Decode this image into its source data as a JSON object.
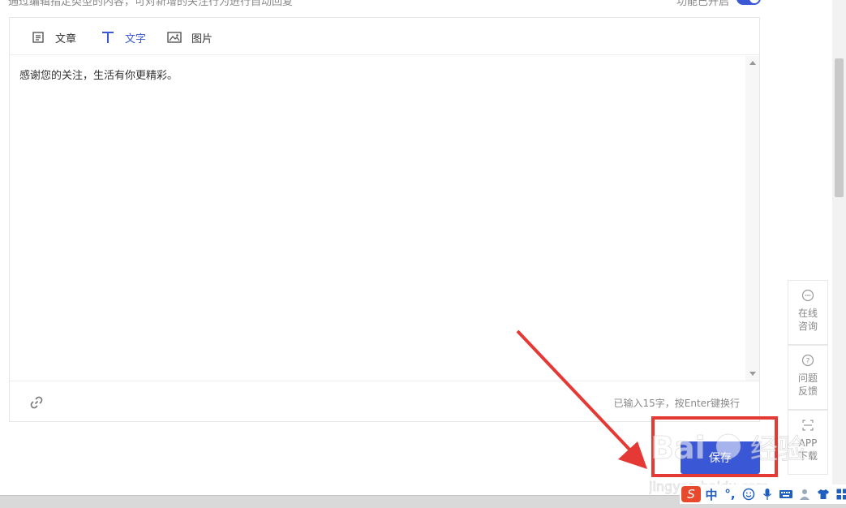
{
  "top": {
    "hint": "通过编辑指定类型的内容，可对新增的关注行为进行自动回复",
    "status": "功能已开启",
    "toggle_on": true
  },
  "tabs": [
    {
      "label": "文章",
      "icon": "article-icon",
      "active": false
    },
    {
      "label": "文字",
      "icon": "text-icon",
      "active": true
    },
    {
      "label": "图片",
      "icon": "image-icon",
      "active": false
    }
  ],
  "editor": {
    "content": "感谢您的关注，生活有你更精彩。",
    "count_text": "已输入15字，按Enter键换行"
  },
  "actions": {
    "save_label": "保存"
  },
  "side_tools": [
    {
      "label": "在线咨询",
      "icon": "chat-icon"
    },
    {
      "label": "问题反馈",
      "icon": "question-icon"
    },
    {
      "label": "APP下载",
      "icon": "qrcode-icon"
    }
  ],
  "ime": {
    "logo": "S",
    "mode": "中",
    "punct": "°,"
  },
  "colors": {
    "accent": "#3a57d6",
    "annotation_red": "#e53935"
  }
}
